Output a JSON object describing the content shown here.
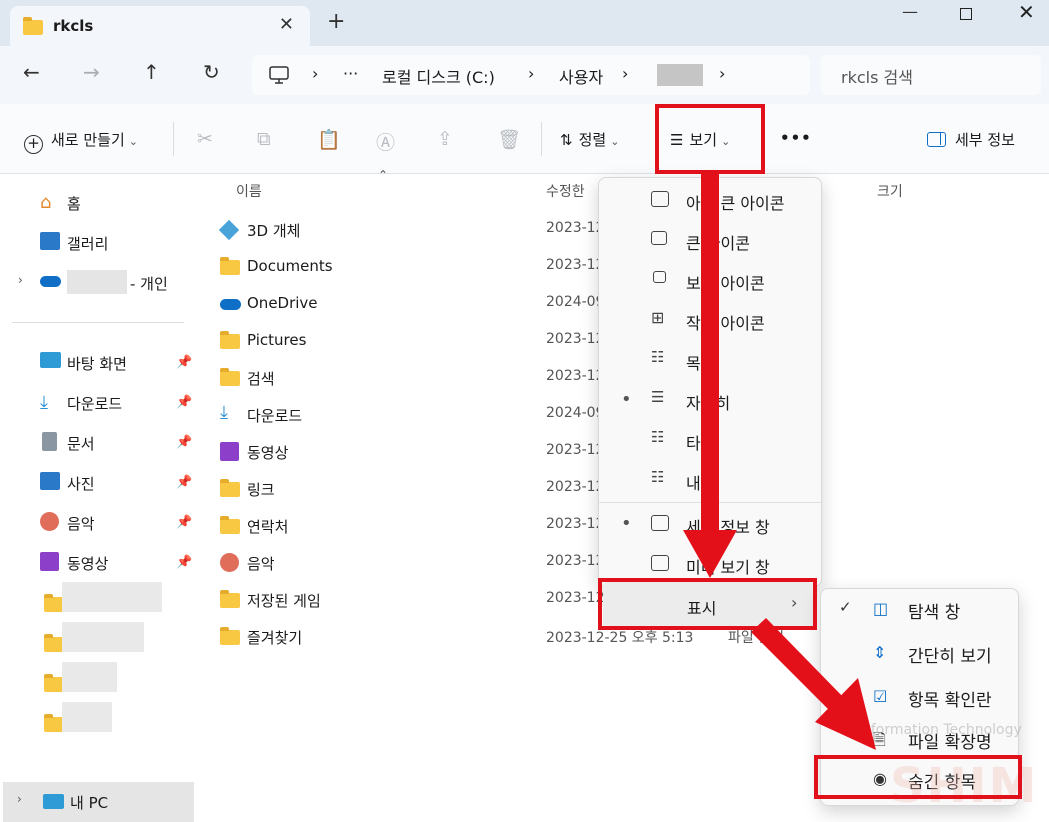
{
  "window": {
    "tab_title": "rkcls",
    "tab_close": "✕",
    "new_tab": "+",
    "minimize": "—",
    "close": "✕"
  },
  "nav": {
    "back": "←",
    "forward": "→",
    "up": "↑",
    "refresh": "↻"
  },
  "address": {
    "segments": [
      "로컬 디스크 (C:)",
      "사용자"
    ],
    "ellipsis": "···",
    "separator": "›"
  },
  "search": {
    "placeholder": "rkcls 검색"
  },
  "toolbar": {
    "new_label": "새로 만들기",
    "sort_label": "정렬",
    "view_label": "보기",
    "more": "•••",
    "details_label": "세부 정보"
  },
  "sidebar": {
    "home": "홈",
    "gallery": "갤러리",
    "onedrive_suffix": "- 개인",
    "quick": [
      {
        "label": "바탕 화면"
      },
      {
        "label": "다운로드"
      },
      {
        "label": "문서"
      },
      {
        "label": "사진"
      },
      {
        "label": "음악"
      },
      {
        "label": "동영상"
      }
    ],
    "pc": "내 PC"
  },
  "columns": {
    "name": "이름",
    "modified": "수정한",
    "size": "크기"
  },
  "files": [
    {
      "name": "3D 개체",
      "date": "2023-12"
    },
    {
      "name": "Documents",
      "date": "2023-12"
    },
    {
      "name": "OneDrive",
      "date": "2024-09"
    },
    {
      "name": "Pictures",
      "date": "2023-12"
    },
    {
      "name": "검색",
      "date": "2023-12"
    },
    {
      "name": "다운로드",
      "date": "2024-09"
    },
    {
      "name": "동영상",
      "date": "2023-12"
    },
    {
      "name": "링크",
      "date": "2023-12"
    },
    {
      "name": "연락처",
      "date": "2023-12"
    },
    {
      "name": "음악",
      "date": "2023-12"
    },
    {
      "name": "저장된 게임",
      "date": "2023-12"
    },
    {
      "name": "즐겨찾기",
      "date": "2023-12-25 오후 5:13",
      "type": "파일 폴더"
    }
  ],
  "view_menu": {
    "items": [
      {
        "label": "아주 큰 아이콘"
      },
      {
        "label": "큰 아이콘"
      },
      {
        "label": "보통 아이콘"
      },
      {
        "label": "작은 아이콘"
      },
      {
        "label": "목록"
      },
      {
        "label": "자세히"
      },
      {
        "label": "타일"
      },
      {
        "label": "내용"
      },
      {
        "label": "세부 정보 창"
      },
      {
        "label": "미리 보기 창"
      }
    ],
    "show_label": "표시"
  },
  "show_submenu": {
    "items": [
      {
        "label": "탐색 창"
      },
      {
        "label": "간단히 보기"
      },
      {
        "label": "항목 확인란"
      },
      {
        "label": "파일 확장명"
      },
      {
        "label": "숨긴 항목"
      }
    ]
  },
  "watermark": {
    "text": "nformation Technology",
    "logo": "SHIM"
  },
  "colors": {
    "annotation_red": "#e0111b",
    "folder_yellow": "#f9c843",
    "onedrive_blue": "#0f6fc6"
  }
}
